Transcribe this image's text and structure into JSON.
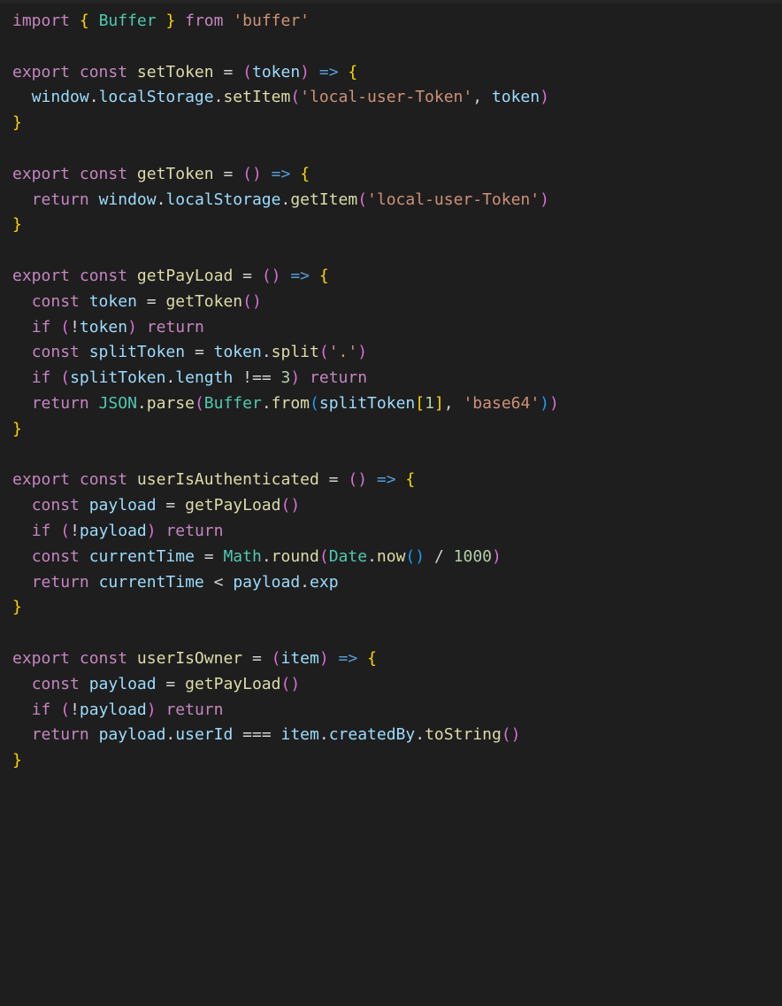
{
  "code": {
    "lines": {
      "l1": {
        "kw_import": "import",
        "brace_o": "{",
        "id_Buffer": "Buffer",
        "brace_c": "}",
        "kw_from": "from",
        "str_buffer": "'buffer'"
      },
      "l3": {
        "kw_export": "export",
        "kw_const": "const",
        "fn_setToken": "setToken",
        "op_eq": "=",
        "paren_o": "(",
        "param_token": "token",
        "paren_c": ")",
        "arrow": "=>",
        "brace_o": "{"
      },
      "l4": {
        "id_window": "window",
        "dot1": ".",
        "id_localStorage": "localStorage",
        "dot2": ".",
        "fn_setItem": "setItem",
        "paren_o": "(",
        "str_key": "'local-user-Token'",
        "comma": ",",
        "id_token": "token",
        "paren_c": ")"
      },
      "l5": {
        "brace_c": "}"
      },
      "l7": {
        "kw_export": "export",
        "kw_const": "const",
        "fn_getToken": "getToken",
        "op_eq": "=",
        "paren_o": "(",
        "paren_c": ")",
        "arrow": "=>",
        "brace_o": "{"
      },
      "l8": {
        "kw_return": "return",
        "id_window": "window",
        "dot1": ".",
        "id_localStorage": "localStorage",
        "dot2": ".",
        "fn_getItem": "getItem",
        "paren_o": "(",
        "str_key": "'local-user-Token'",
        "paren_c": ")"
      },
      "l9": {
        "brace_c": "}"
      },
      "l11": {
        "kw_export": "export",
        "kw_const": "const",
        "fn_getPayLoad": "getPayLoad",
        "op_eq": "=",
        "paren_o": "(",
        "paren_c": ")",
        "arrow": "=>",
        "brace_o": "{"
      },
      "l12": {
        "kw_const": "const",
        "id_token": "token",
        "op_eq": "=",
        "fn_getToken": "getToken",
        "paren_o": "(",
        "paren_c": ")"
      },
      "l13": {
        "kw_if": "if",
        "paren_o": "(",
        "op_not": "!",
        "id_token": "token",
        "paren_c": ")",
        "kw_return": "return"
      },
      "l14": {
        "kw_const": "const",
        "id_splitToken": "splitToken",
        "op_eq": "=",
        "id_token": "token",
        "dot": ".",
        "fn_split": "split",
        "paren_o": "(",
        "str_dot": "'.'",
        "paren_c": ")"
      },
      "l15": {
        "kw_if": "if",
        "paren_o": "(",
        "id_splitToken": "splitToken",
        "dot": ".",
        "id_length": "length",
        "op_neq": "!==",
        "num_3": "3",
        "paren_c": ")",
        "kw_return": "return"
      },
      "l16": {
        "kw_return": "return",
        "id_JSON": "JSON",
        "dot1": ".",
        "fn_parse": "parse",
        "paren_o1": "(",
        "id_Buffer": "Buffer",
        "dot2": ".",
        "fn_from": "from",
        "paren_o2": "(",
        "id_splitToken": "splitToken",
        "brack_o": "[",
        "num_1": "1",
        "brack_c": "]",
        "comma": ",",
        "str_b64": "'base64'",
        "paren_c2": ")",
        "paren_c1": ")"
      },
      "l17": {
        "brace_c": "}"
      },
      "l19": {
        "kw_export": "export",
        "kw_const": "const",
        "fn_userIsAuthenticated": "userIsAuthenticated",
        "op_eq": "=",
        "paren_o": "(",
        "paren_c": ")",
        "arrow": "=>",
        "brace_o": "{"
      },
      "l20": {
        "kw_const": "const",
        "id_payload": "payload",
        "op_eq": "=",
        "fn_getPayLoad": "getPayLoad",
        "paren_o": "(",
        "paren_c": ")"
      },
      "l21": {
        "kw_if": "if",
        "paren_o": "(",
        "op_not": "!",
        "id_payload": "payload",
        "paren_c": ")",
        "kw_return": "return"
      },
      "l22": {
        "kw_const": "const",
        "id_currentTime": "currentTime",
        "op_eq": "=",
        "id_Math": "Math",
        "dot1": ".",
        "fn_round": "round",
        "paren_o1": "(",
        "id_Date": "Date",
        "dot2": ".",
        "fn_now": "now",
        "paren_o2": "(",
        "paren_c2": ")",
        "op_div": "/",
        "num_1000": "1000",
        "paren_c1": ")"
      },
      "l23": {
        "kw_return": "return",
        "id_currentTime": "currentTime",
        "op_lt": "<",
        "id_payload": "payload",
        "dot": ".",
        "id_exp": "exp"
      },
      "l24": {
        "brace_c": "}"
      },
      "l26": {
        "kw_export": "export",
        "kw_const": "const",
        "fn_userIsOwner": "userIsOwner",
        "op_eq": "=",
        "paren_o": "(",
        "param_item": "item",
        "paren_c": ")",
        "arrow": "=>",
        "brace_o": "{"
      },
      "l27": {
        "kw_const": "const",
        "id_payload": "payload",
        "op_eq": "=",
        "fn_getPayLoad": "getPayLoad",
        "paren_o": "(",
        "paren_c": ")"
      },
      "l28": {
        "kw_if": "if",
        "paren_o": "(",
        "op_not": "!",
        "id_payload": "payload",
        "paren_c": ")",
        "kw_return": "return"
      },
      "l29": {
        "kw_return": "return",
        "id_payload": "payload",
        "dot1": ".",
        "id_userId": "userId",
        "op_eqeq": "===",
        "id_item": "item",
        "dot2": ".",
        "id_createdBy": "createdBy",
        "dot3": ".",
        "fn_toString": "toString",
        "paren_o": "(",
        "paren_c": ")"
      },
      "l30": {
        "brace_c": "}"
      }
    }
  },
  "colors": {
    "background": "#1e1e1e",
    "keyword": "#c586c0",
    "identifier": "#9cdcfe",
    "function": "#dcdcaa",
    "type": "#4ec9b0",
    "string": "#ce9178",
    "number": "#b5cea8",
    "brace": "#ffd700",
    "paren": "#da70d6",
    "bracket": "#179fff",
    "arrow": "#569cd6"
  }
}
